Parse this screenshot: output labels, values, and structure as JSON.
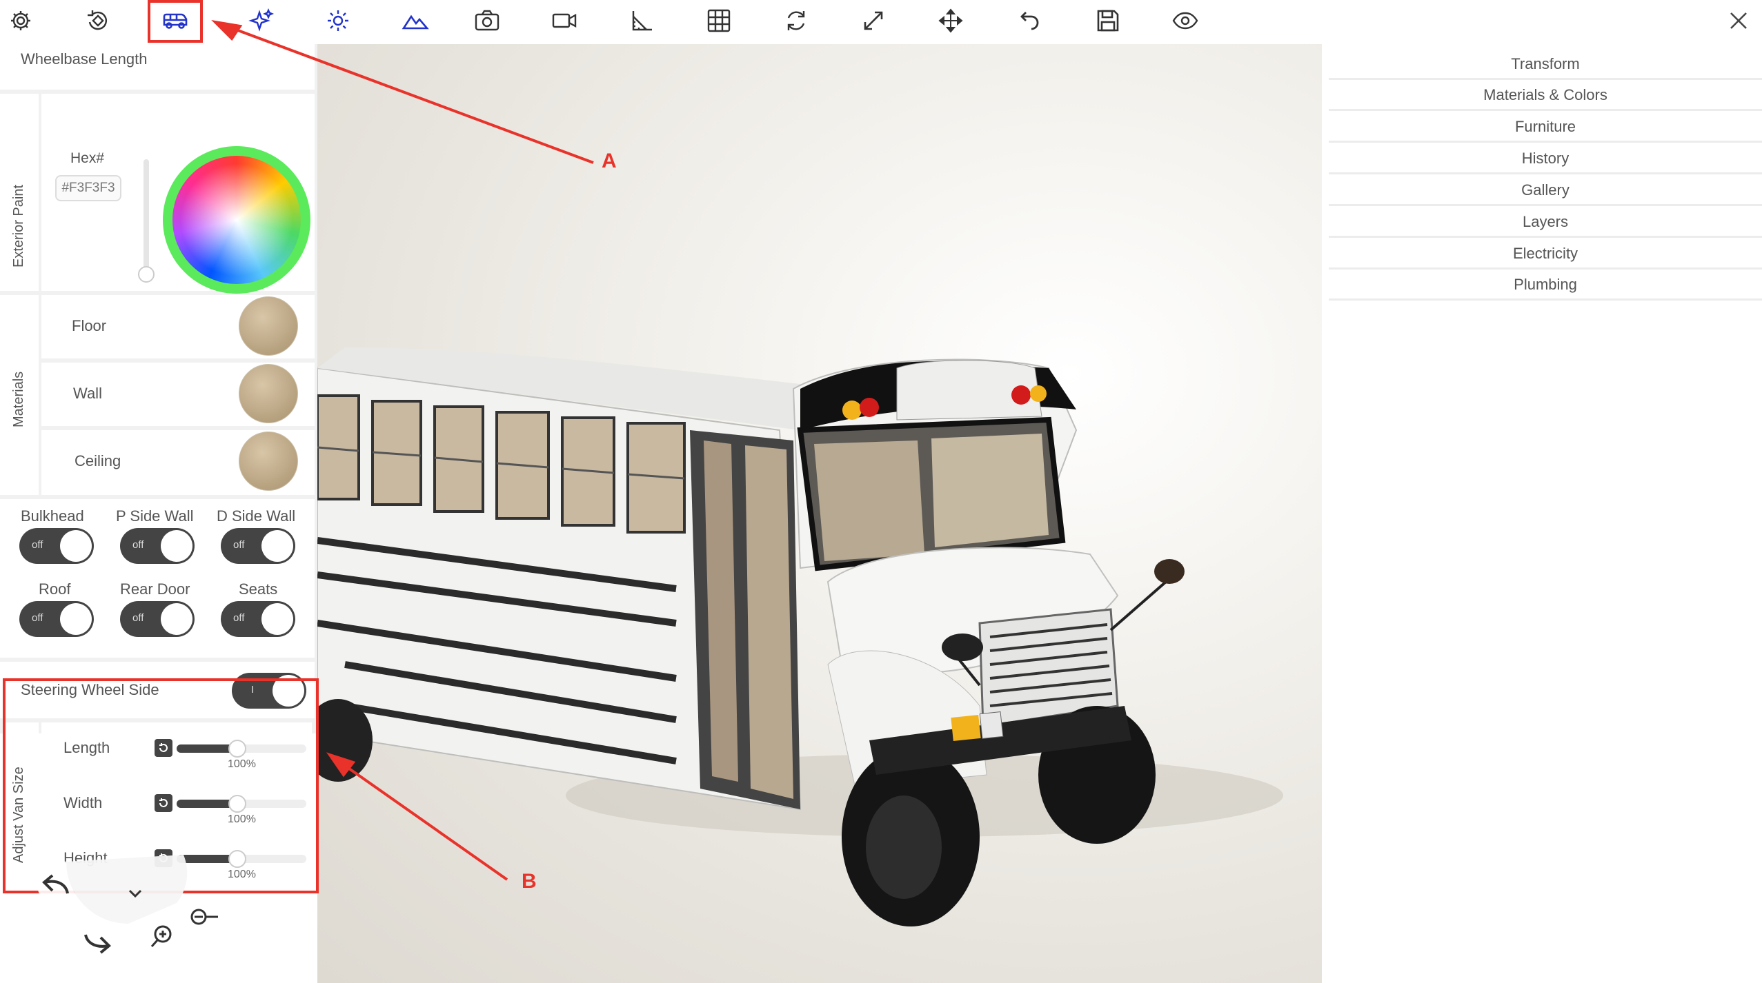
{
  "toolbar": {
    "icons": [
      "gear-icon",
      "rotate-object-icon",
      "van-icon",
      "sparkles-icon",
      "sun-icon",
      "terrain-icon",
      "camera-icon",
      "video-icon",
      "measure-icon",
      "grid-icon",
      "refresh-icon",
      "expand-icon",
      "move-icon",
      "undo-icon",
      "save-icon",
      "eye-icon"
    ],
    "active": "van-icon",
    "accent": "#2233cc",
    "close_icon": "close-icon"
  },
  "left_panel": {
    "wheelbase_label": "Wheelbase Length",
    "exterior_paint": {
      "section_label": "Exterior Paint",
      "hex_label": "Hex#",
      "hex_value": "#F3F3F3"
    },
    "materials": {
      "section_label": "Materials",
      "items": [
        {
          "label": "Floor"
        },
        {
          "label": "Wall"
        },
        {
          "label": "Ceiling"
        }
      ]
    },
    "toggles": [
      {
        "label": "Bulkhead",
        "state": "off"
      },
      {
        "label": "P Side Wall",
        "state": "off"
      },
      {
        "label": "D Side Wall",
        "state": "off"
      },
      {
        "label": "Roof",
        "state": "off"
      },
      {
        "label": "Rear Door",
        "state": "off"
      },
      {
        "label": "Seats",
        "state": "off"
      }
    ],
    "steering": {
      "label": "Steering Wheel Side",
      "state": "I"
    },
    "van_size": {
      "section_label": "Adjust Van Size",
      "sliders": [
        {
          "label": "Length",
          "value": "100%",
          "fraction": 0.47
        },
        {
          "label": "Width",
          "value": "100%",
          "fraction": 0.47
        },
        {
          "label": "Height",
          "value": "100%",
          "fraction": 0.47
        }
      ]
    }
  },
  "right_panel": {
    "menu": [
      "Transform",
      "Materials & Colors",
      "Furniture",
      "History",
      "Gallery",
      "Layers",
      "Electricity",
      "Plumbing"
    ]
  },
  "annotations": {
    "a": "A",
    "b": "B",
    "color": "#e8322a"
  }
}
